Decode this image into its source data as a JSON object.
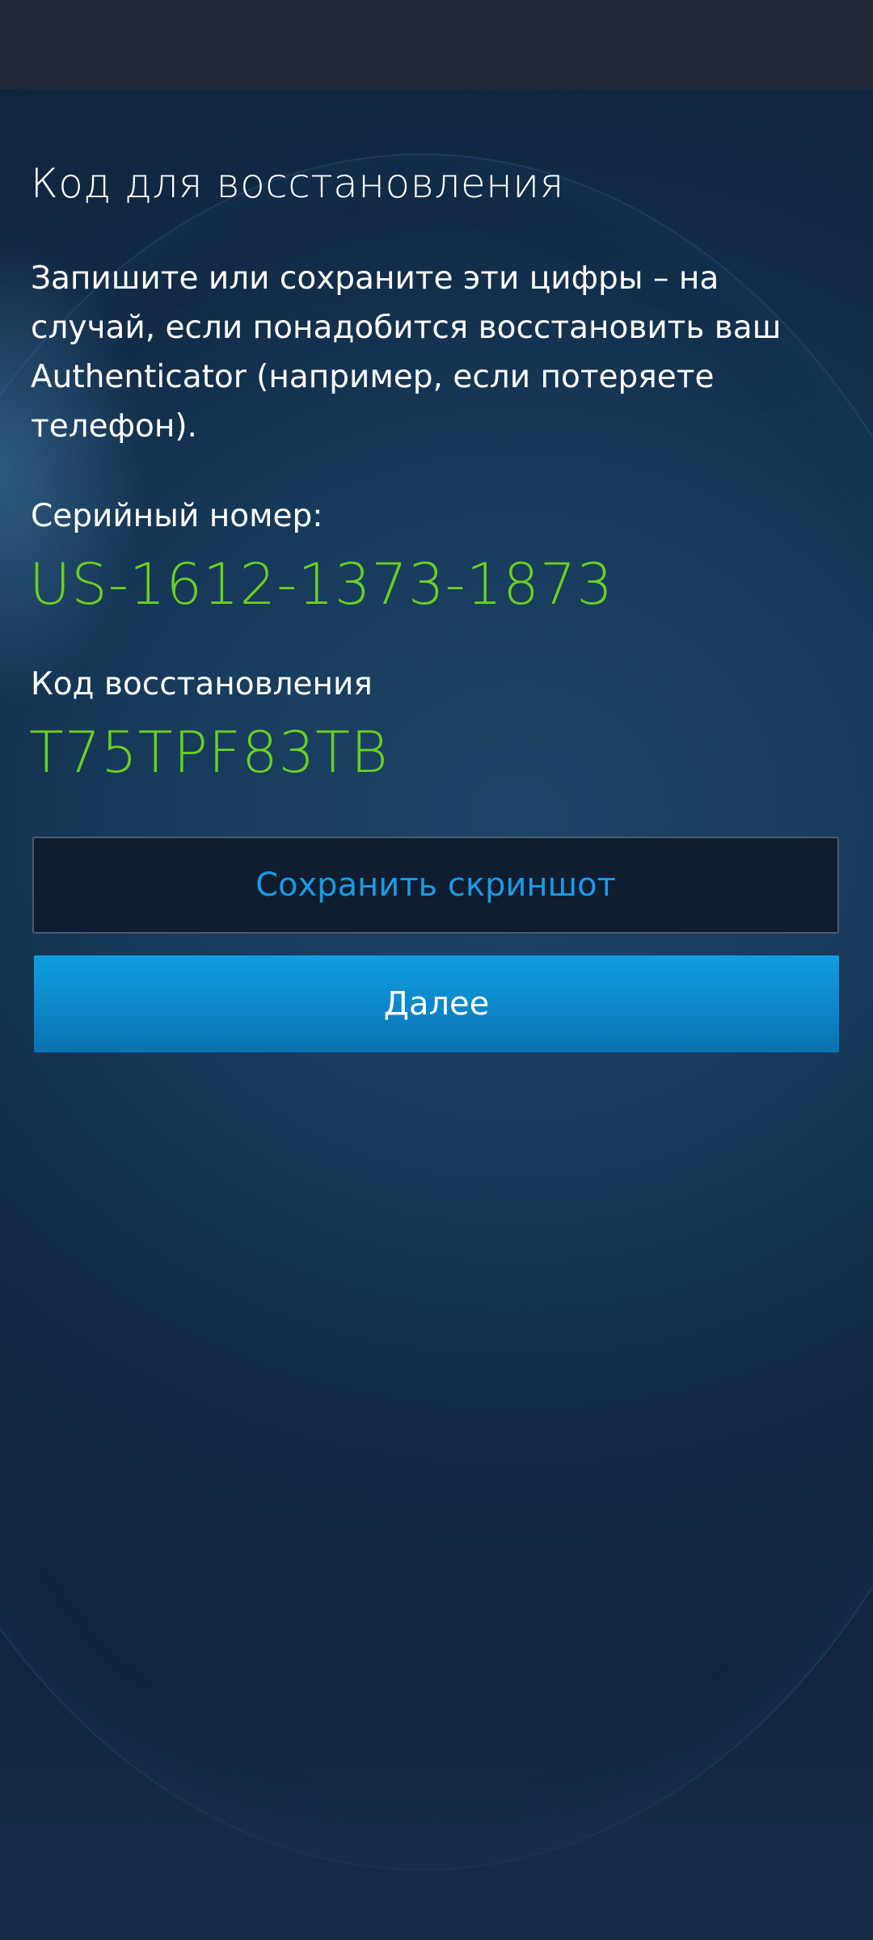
{
  "header": {
    "title": "Код для восстановления"
  },
  "main": {
    "description": "Запишите или сохраните эти цифры – на случай, если понадобится восстановить ваш Authenticator (например, если потеряете телефон).",
    "serial_label": "Серийный номер:",
    "serial_value": "US-1612-1373-1873",
    "code_label": "Код восстановления",
    "code_value": "T75TPF83TB"
  },
  "actions": {
    "save_screenshot_label": "Сохранить скриншот",
    "next_label": "Далее"
  },
  "colors": {
    "accent_green": "#6ad11e",
    "accent_blue": "#1a9be6",
    "primary_button": "#0c86c8",
    "status_bar": "#222a3a",
    "background": "#13253e"
  }
}
